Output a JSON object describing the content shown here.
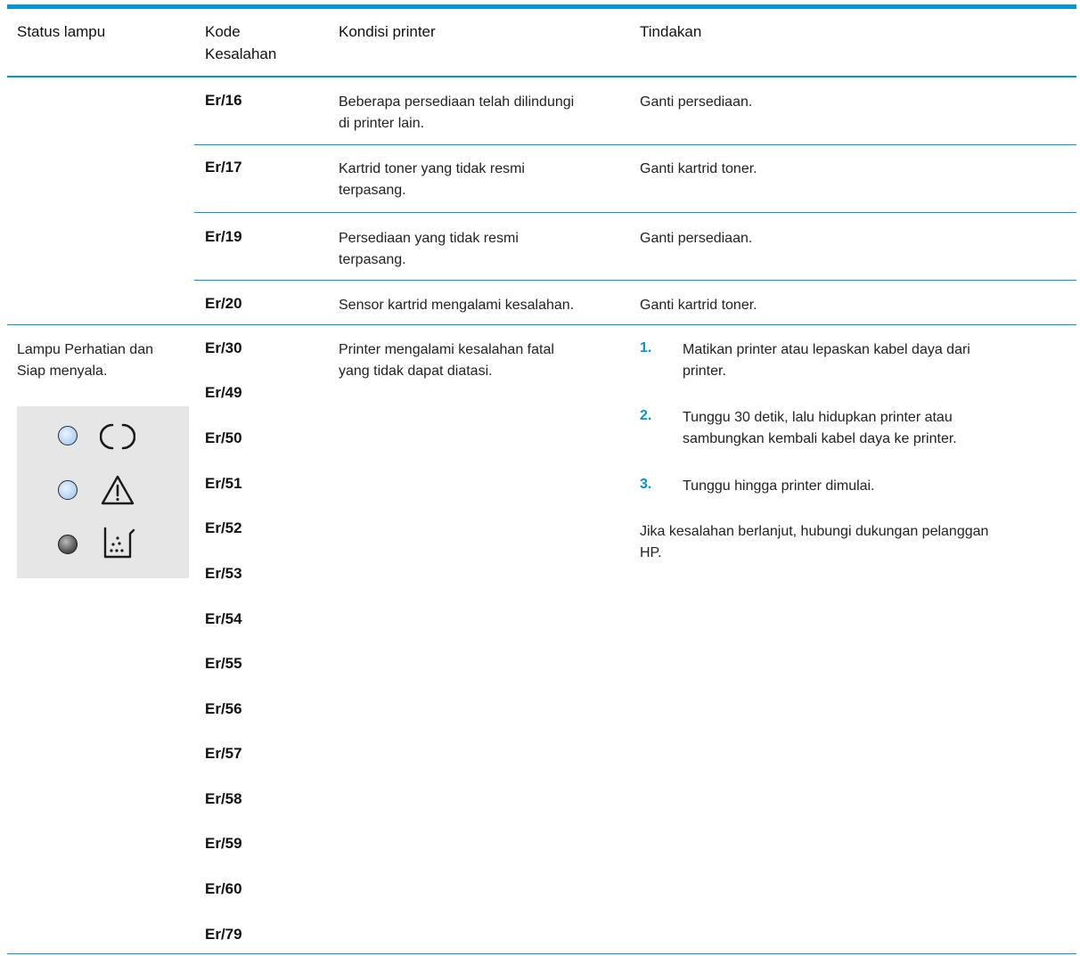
{
  "header": {
    "status": "Status lampu",
    "code_line1": "Kode",
    "code_line2": "Kesalahan",
    "condition": "Kondisi printer",
    "action": "Tindakan"
  },
  "rows_top": [
    {
      "code": "Er/16",
      "condition": [
        "Beberapa persediaan telah dilindungi",
        "di printer lain."
      ],
      "action": "Ganti persediaan."
    },
    {
      "code": "Er/17",
      "condition": [
        "Kartrid toner yang tidak resmi",
        "terpasang."
      ],
      "action": "Ganti kartrid toner."
    },
    {
      "code": "Er/19",
      "condition": [
        "Persediaan yang tidak resmi",
        "terpasang."
      ],
      "action": "Ganti persediaan."
    },
    {
      "code": "Er/20",
      "condition": [
        "Sensor kartrid mengalami kesalahan."
      ],
      "action": "Ganti kartrid toner."
    }
  ],
  "fatal_row": {
    "status_lines": [
      "Lampu Perhatian dan",
      "Siap menyala."
    ],
    "lights": [
      {
        "led": "on",
        "icon": "ready-power-icon"
      },
      {
        "led": "on",
        "icon": "attention-warning-icon"
      },
      {
        "led": "off",
        "icon": "toner-icon"
      }
    ],
    "codes": [
      "Er/30",
      "Er/49",
      "Er/50",
      "Er/51",
      "Er/52",
      "Er/53",
      "Er/54",
      "Er/55",
      "Er/56",
      "Er/57",
      "Er/58",
      "Er/59",
      "Er/60",
      "Er/79"
    ],
    "condition": [
      "Printer mengalami kesalahan fatal",
      "yang tidak dapat diatasi."
    ],
    "steps": [
      {
        "num": "1.",
        "lines": [
          "Matikan printer atau lepaskan kabel daya dari",
          "printer."
        ]
      },
      {
        "num": "2.",
        "lines": [
          "Tunggu 30 detik, lalu hidupkan printer atau",
          "sambungkan kembali kabel daya ke printer."
        ]
      },
      {
        "num": "3.",
        "lines": [
          "Tunggu hingga printer dimulai."
        ]
      }
    ],
    "note": [
      "Jika kesalahan berlanjut, hubungi dukungan pelanggan",
      "HP."
    ]
  },
  "colors": {
    "accent": "#0096d6",
    "lights_bg": "#e6e6e6"
  }
}
